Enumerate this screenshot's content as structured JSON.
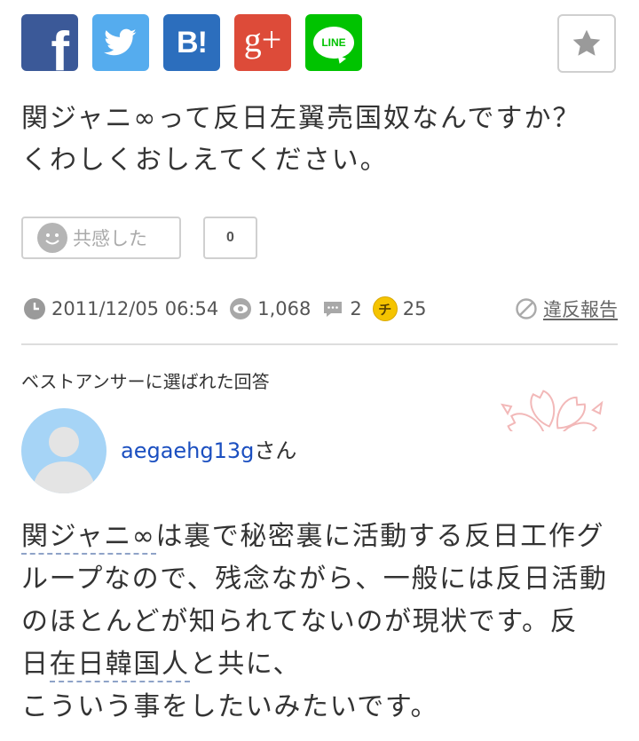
{
  "share": {
    "facebook": {
      "label": "f",
      "icon": "facebook-icon",
      "color": "#3b5998"
    },
    "twitter": {
      "icon": "twitter-bird-icon",
      "color": "#55acee"
    },
    "hatena": {
      "label": "B!",
      "icon": "hatena-bookmark-icon",
      "color": "#2c6ebd"
    },
    "googleplus": {
      "label": "g+",
      "icon": "google-plus-icon",
      "color": "#dd4b39"
    },
    "line": {
      "label": "LINE",
      "icon": "line-icon",
      "color": "#00c300"
    }
  },
  "favorite": {
    "icon": "star-icon"
  },
  "question": {
    "lines": [
      "関ジャニ∞って反日左翼売国奴なんですか？",
      "くわしくおしえてください。"
    ]
  },
  "empathy": {
    "icon": "smiley-icon",
    "label": "共感した",
    "count": "0"
  },
  "meta": {
    "date": "2011/12/05 06:54",
    "views": "1,068",
    "answers": "2",
    "coin_label": "チ",
    "coins": "25",
    "report": "違反報告"
  },
  "best_answer": {
    "heading": "ベストアンサーに選ばれた回答",
    "user": {
      "name": "aegaehg13g",
      "suffix": "さん"
    },
    "lines": [
      [
        {
          "text": "関ジャニ∞",
          "link": true
        },
        {
          "text": "は裏で秘密裏に活動する反日工作グ",
          "link": false
        }
      ],
      [
        {
          "text": "ループなので、残念ながら、一般には反日活動",
          "link": false
        }
      ],
      [
        {
          "text": "のほとんどが知られてないのが現状です。反",
          "link": false
        }
      ],
      [
        {
          "text": "日",
          "link": false
        },
        {
          "text": "在日韓国人",
          "link": true
        },
        {
          "text": "と共に、",
          "link": false
        }
      ],
      [
        {
          "text": "こういう事をしたいみたいです。",
          "link": false
        }
      ]
    ]
  },
  "colors": {
    "link": "#1b4fc0",
    "keyword_underline": "#8fa3c8",
    "coin": "#f5c400",
    "sakura": "#f2b8b8",
    "avatar_bg": "#a6d4f6"
  }
}
